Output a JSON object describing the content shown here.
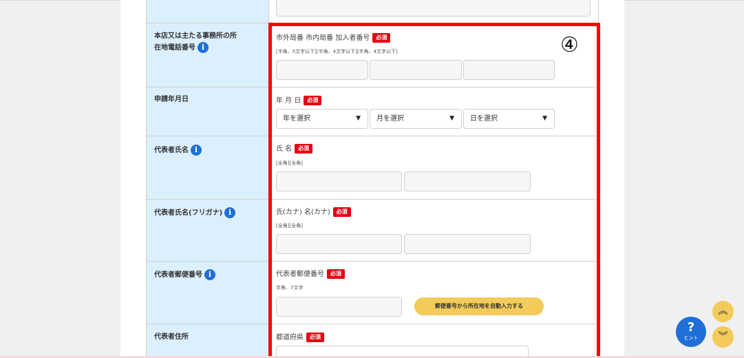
{
  "rows": [
    {
      "label_line1": "本店又は主たる事務所の所",
      "label_line2": "在地電話番号"
    },
    {
      "label": "申請年月日"
    },
    {
      "label": "代表者氏名"
    },
    {
      "label": "代表者氏名(フリガナ)"
    },
    {
      "label": "代表者郵便番号"
    },
    {
      "label": "代表者住所"
    }
  ],
  "fields": {
    "phone": {
      "label": "市外局番 市内局番 加入者番号",
      "hint": "[半角、5文字以下][半角、4文字以下][半角、4文字以下]"
    },
    "date": {
      "label": "年 月 日",
      "year": "年を選択",
      "month": "月を選択",
      "day": "日を選択"
    },
    "name": {
      "label": "氏 名",
      "hint": "[全角][全角]"
    },
    "kana": {
      "label": "氏(カナ) 名(カナ)",
      "hint": "[全角][全角]"
    },
    "postal": {
      "label": "代表者郵便番号",
      "hint": "半角、7文字",
      "button": "郵便番号から所在地を自動入力する"
    },
    "address": {
      "label": "都道府県"
    }
  },
  "required_badge": "必須",
  "info_icon_glyph": "i",
  "dropdown_arrow": "▼",
  "annotation_number": "④",
  "hint_button": {
    "mark": "?",
    "label": "ヒント"
  },
  "scroll": {
    "up": "︽",
    "down": "︾"
  },
  "colors": {
    "label_bg": "#dbeffd",
    "required": "#e60012",
    "accent_yellow": "#f2cb5a",
    "info_blue": "#1f6fd6",
    "highlight": "#ff0000"
  }
}
